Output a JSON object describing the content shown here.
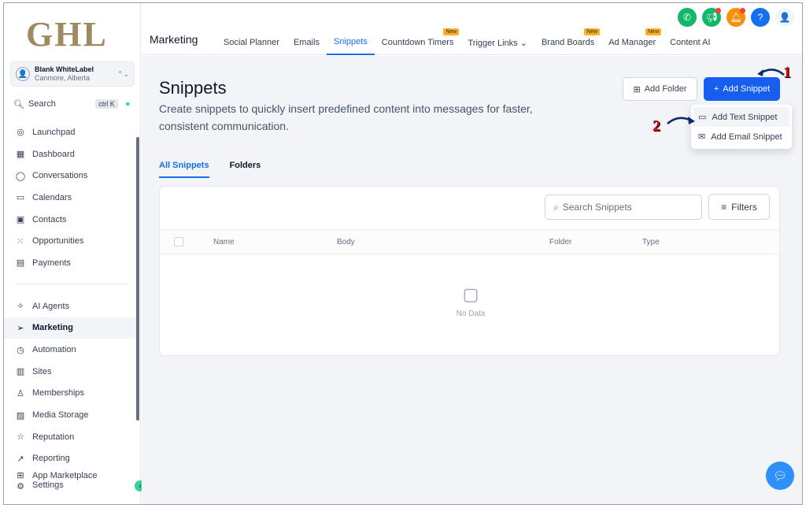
{
  "logo": "GHL",
  "account": {
    "name": "Blank WhiteLabel",
    "location": "Canmore, Alberta"
  },
  "search": {
    "label": "Search",
    "shortcut": "ctrl K"
  },
  "nav": {
    "items": [
      {
        "label": "Launchpad",
        "icon": "launchpad-icon"
      },
      {
        "label": "Dashboard",
        "icon": "dashboard-icon"
      },
      {
        "label": "Conversations",
        "icon": "chat-icon"
      },
      {
        "label": "Calendars",
        "icon": "calendar-icon"
      },
      {
        "label": "Contacts",
        "icon": "contacts-icon"
      },
      {
        "label": "Opportunities",
        "icon": "opportunities-icon"
      },
      {
        "label": "Payments",
        "icon": "payments-icon"
      }
    ],
    "items2": [
      {
        "label": "AI Agents",
        "icon": "sparkle-icon"
      },
      {
        "label": "Marketing",
        "icon": "send-icon"
      },
      {
        "label": "Automation",
        "icon": "automation-icon"
      },
      {
        "label": "Sites",
        "icon": "sites-icon"
      },
      {
        "label": "Memberships",
        "icon": "memberships-icon"
      },
      {
        "label": "Media Storage",
        "icon": "image-icon"
      },
      {
        "label": "Reputation",
        "icon": "star-icon"
      },
      {
        "label": "Reporting",
        "icon": "chart-icon"
      },
      {
        "label": "App Marketplace",
        "icon": "apps-icon"
      },
      {
        "label": "Settings",
        "icon": "gear-icon"
      }
    ]
  },
  "topbar": {
    "title": "Marketing",
    "tabs": [
      {
        "label": "Social Planner",
        "new": false
      },
      {
        "label": "Emails",
        "new": false
      },
      {
        "label": "Snippets",
        "new": false
      },
      {
        "label": "Countdown Timers",
        "new": true
      },
      {
        "label": "Trigger Links ⌄",
        "new": false
      },
      {
        "label": "Brand Boards",
        "new": true
      },
      {
        "label": "Ad Manager",
        "new": true
      },
      {
        "label": "Content AI",
        "new": false
      }
    ],
    "new_badge": "New"
  },
  "page": {
    "title": "Snippets",
    "subtitle": "Create snippets to quickly insert predefined content into messages for faster, consistent communication."
  },
  "buttons": {
    "add_folder": "Add Folder",
    "add_snippet": "Add Snippet"
  },
  "dropdown": {
    "text": "Add Text Snippet",
    "email": "Add Email Snippet"
  },
  "annotations": {
    "one": "1",
    "two": "2"
  },
  "subtabs": {
    "all": "All Snippets",
    "folders": "Folders"
  },
  "table": {
    "search_placeholder": "Search Snippets",
    "filters": "Filters",
    "columns": [
      "Name",
      "Body",
      "Folder",
      "Type"
    ],
    "empty": "No Data"
  },
  "colors": {
    "primary": "#155eef",
    "accent": "#3ccf91",
    "logo": "#9f8a62"
  }
}
